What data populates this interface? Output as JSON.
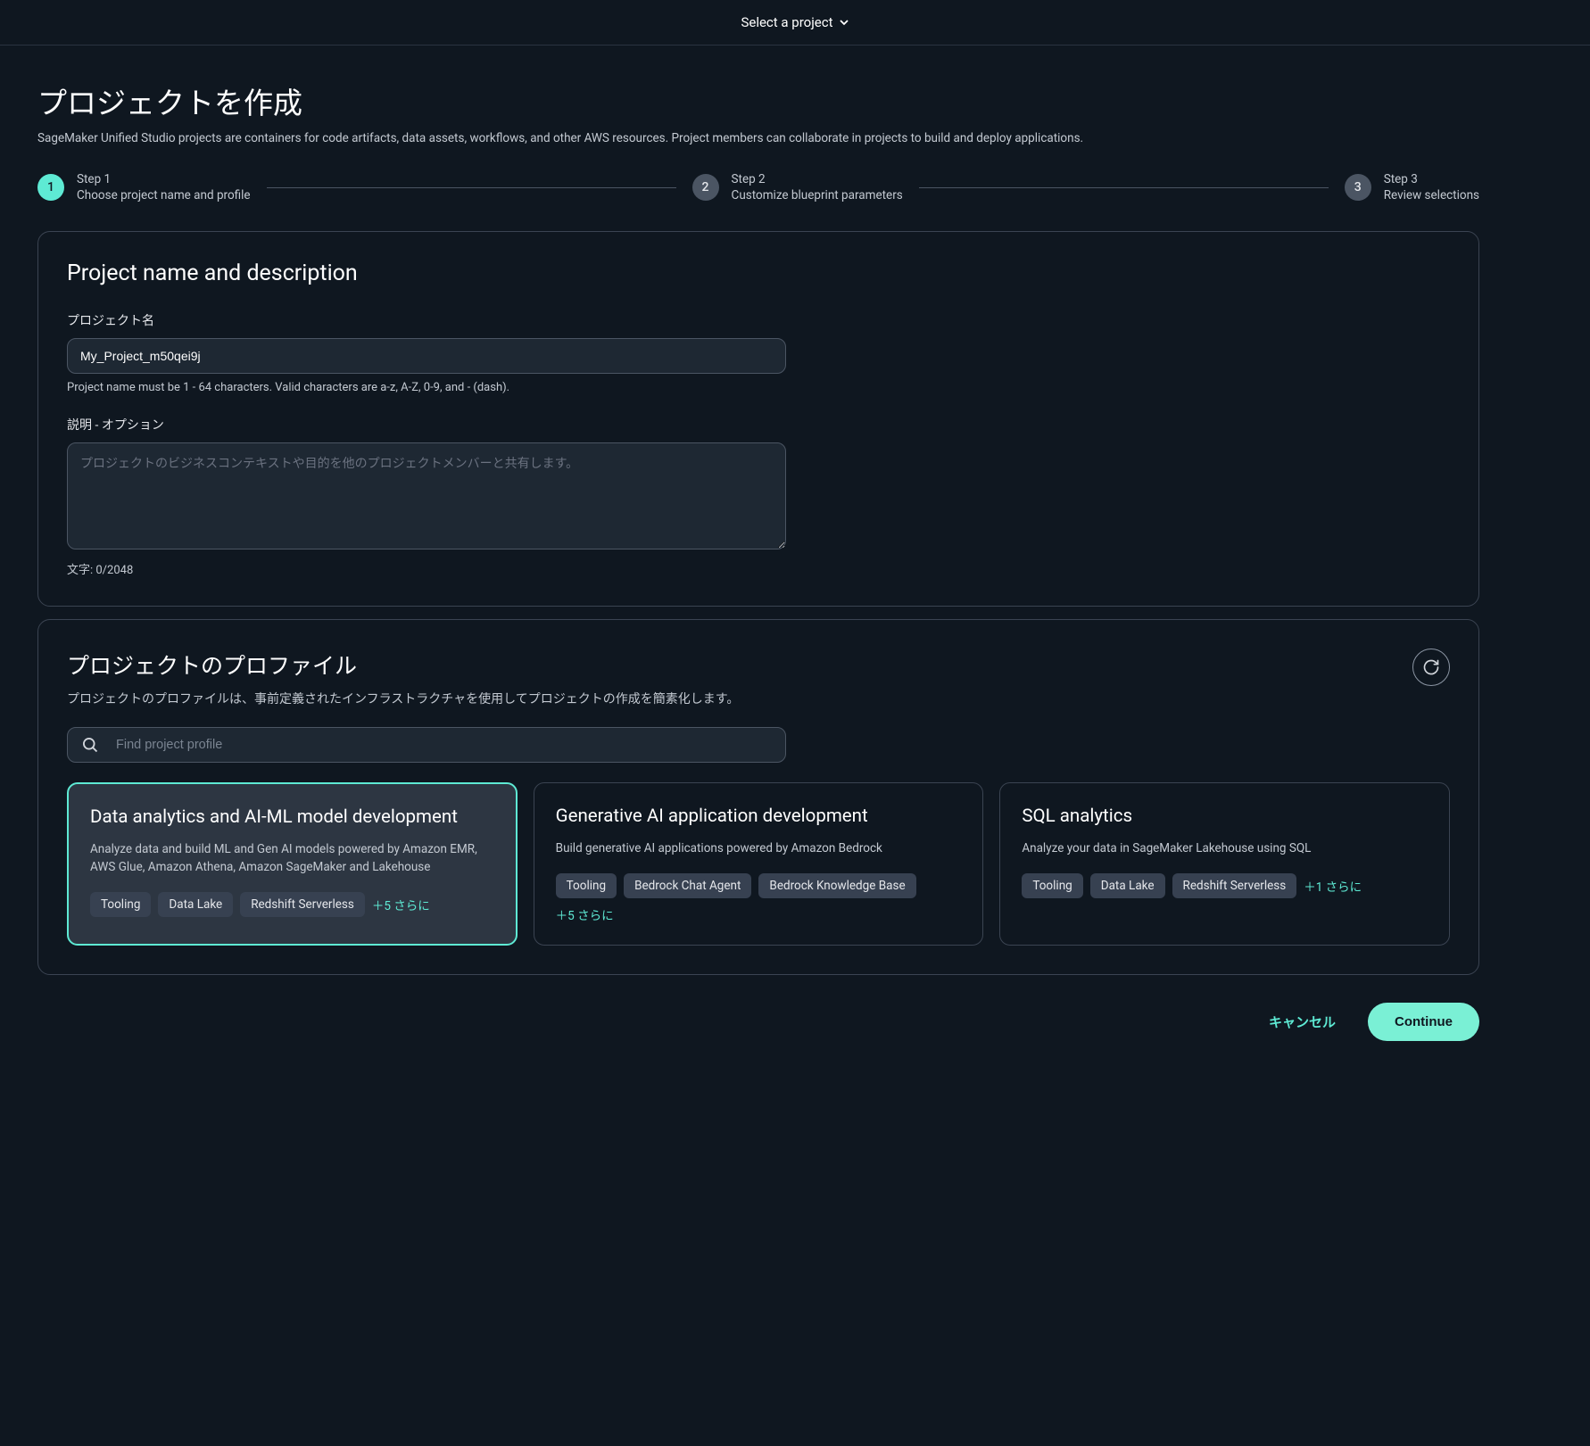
{
  "topbar": {
    "selector_label": "Select a project"
  },
  "page": {
    "title": "プロジェクトを作成",
    "subtitle": "SageMaker Unified Studio projects are containers for code artifacts, data assets, workflows, and other AWS resources. Project members can collaborate in projects to build and deploy applications."
  },
  "stepper": {
    "steps": [
      {
        "num": "1",
        "label": "Step 1",
        "desc": "Choose project name and profile",
        "active": true
      },
      {
        "num": "2",
        "label": "Step 2",
        "desc": "Customize blueprint parameters",
        "active": false
      },
      {
        "num": "3",
        "label": "Step 3",
        "desc": "Review selections",
        "active": false
      }
    ]
  },
  "nameSection": {
    "heading": "Project name and description",
    "name_label": "プロジェクト名",
    "name_value": "My_Project_m50qei9j",
    "name_hint": "Project name must be 1 - 64 characters. Valid characters are a-z, A-Z, 0-9, and - (dash).",
    "desc_label": "説明 - オプション",
    "desc_placeholder": "プロジェクトのビジネスコンテキストや目的を他のプロジェクトメンバーと共有します。",
    "char_count": "文字: 0/2048"
  },
  "profileSection": {
    "heading": "プロジェクトのプロファイル",
    "subtitle": "プロジェクトのプロファイルは、事前定義されたインフラストラクチャを使用してプロジェクトの作成を簡素化します。",
    "search_placeholder": "Find project profile",
    "cards": [
      {
        "title": "Data analytics and AI-ML model development",
        "desc": "Analyze data and build ML and Gen AI models powered by Amazon EMR, AWS Glue, Amazon Athena, Amazon SageMaker and Lakehouse",
        "tags": [
          "Tooling",
          "Data Lake",
          "Redshift Serverless"
        ],
        "more": "＋5 さらに",
        "selected": true
      },
      {
        "title": "Generative AI application development",
        "desc": "Build generative AI applications powered by Amazon Bedrock",
        "tags": [
          "Tooling",
          "Bedrock Chat Agent",
          "Bedrock Knowledge Base"
        ],
        "more": "＋5 さらに",
        "selected": false
      },
      {
        "title": "SQL analytics",
        "desc": "Analyze your data in SageMaker Lakehouse using SQL",
        "tags": [
          "Tooling",
          "Data Lake",
          "Redshift Serverless"
        ],
        "more": "＋1 さらに",
        "selected": false
      }
    ]
  },
  "footer": {
    "cancel": "キャンセル",
    "continue": "Continue"
  }
}
